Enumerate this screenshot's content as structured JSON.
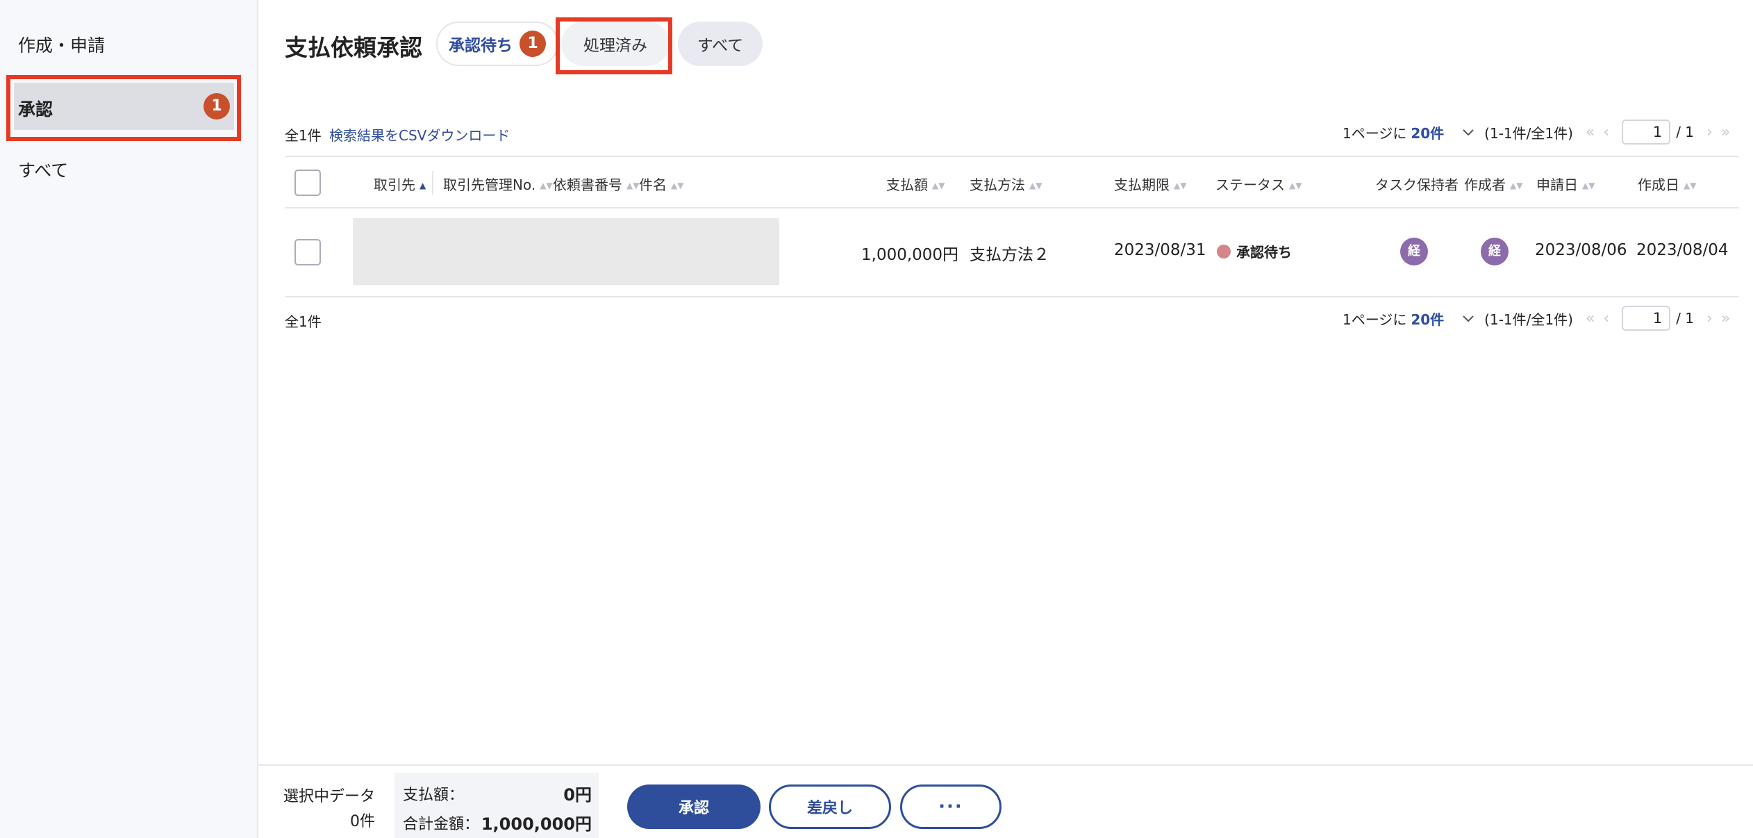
{
  "sidebar": {
    "items": [
      {
        "label": "作成・申請"
      },
      {
        "label": "承認",
        "badge": "1",
        "active": true
      },
      {
        "label": "すべて"
      }
    ]
  },
  "header": {
    "title": "支払依頼承認",
    "tabs": [
      {
        "label": "承認待ち",
        "badge": "1",
        "selected": true
      },
      {
        "label": "処理済み"
      },
      {
        "label": "すべて"
      }
    ]
  },
  "toolbar": {
    "total": "全1件",
    "csv_link": "検索結果をCSVダウンロード"
  },
  "pager": {
    "per_page_prefix": "1ページに",
    "per_page_value": "20件",
    "range": "(1-1件/全1件)",
    "first_icon": "«",
    "prev_icon": "‹",
    "current_page": "1",
    "of_pages": "/ 1",
    "next_icon": "›",
    "last_icon": "»"
  },
  "table": {
    "columns": [
      {
        "label": "取引先"
      },
      {
        "label": "取引先管理No."
      },
      {
        "label": "依頼書番号"
      },
      {
        "label": "件名"
      },
      {
        "label": "支払額"
      },
      {
        "label": "支払方法"
      },
      {
        "label": "支払期限"
      },
      {
        "label": "ステータス"
      },
      {
        "label": "タスク保持者"
      },
      {
        "label": "作成者"
      },
      {
        "label": "申請日"
      },
      {
        "label": "作成日"
      }
    ],
    "rows": [
      {
        "amount": "1,000,000円",
        "method": "支払方法２",
        "due": "2023/08/31",
        "status": "承認待ち",
        "status_color": "#d5858a",
        "task_holder": "経",
        "creator": "経",
        "applied": "2023/08/06",
        "created": "2023/08/04"
      }
    ]
  },
  "footer_count": "全1件",
  "bottom": {
    "selected_label": "選択中データ",
    "selected_count": "0件",
    "payment_label": "支払額：",
    "payment_value": "0円",
    "total_label": "合計金額：",
    "total_value": "1,000,000円",
    "approve": "承認",
    "reject": "差戻し",
    "more": "···"
  },
  "colors": {
    "accent": "#2e4d9b",
    "badge": "#c8502a",
    "highlight_frame": "#e63a25",
    "avatar": "#8c6bab"
  }
}
